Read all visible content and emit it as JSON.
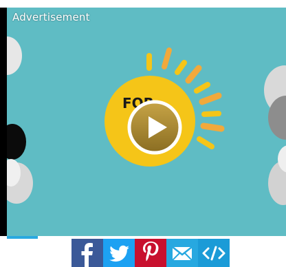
{
  "player": {
    "ad_label": "Advertisement",
    "background_color": "#5fbcc4",
    "sun_color": "#f5c518",
    "ray_color": "#f2a93b",
    "artwork_text": "FOR",
    "play_icon": "play-icon",
    "progress_fraction": 0.11,
    "progress_color": "#29a9e0"
  },
  "share": {
    "buttons": [
      {
        "icon": "facebook-icon",
        "color": "#3b5998"
      },
      {
        "icon": "twitter-icon",
        "color": "#1da1f2"
      },
      {
        "icon": "pinterest-icon",
        "color": "#c8102e"
      },
      {
        "icon": "email-icon",
        "color": "#27a8e0"
      },
      {
        "icon": "embed-code-icon",
        "color": "#1b9bd7"
      }
    ]
  }
}
